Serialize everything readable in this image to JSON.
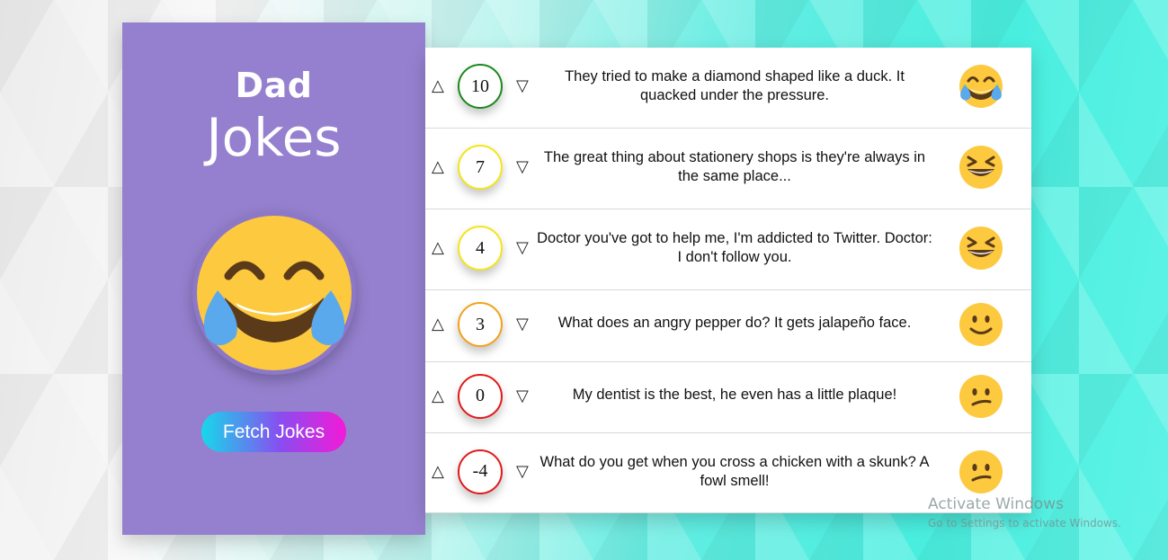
{
  "sidebar": {
    "title_line1": "Dad",
    "title_line2": "Jokes",
    "fetch_button": "Fetch Jokes"
  },
  "jokes": [
    {
      "score": "10",
      "score_color": "#1a8a1a",
      "text": "They tried to make a diamond shaped like a duck. It quacked under the pressure.",
      "emoji": "rolling-laughing-emoji"
    },
    {
      "score": "7",
      "score_color": "#f2e61a",
      "text": "The great thing about stationery shops is they're always in the same place...",
      "emoji": "grinning-squinting-emoji"
    },
    {
      "score": "4",
      "score_color": "#f2e61a",
      "text": "Doctor you've got to help me, I'm addicted to Twitter. Doctor: I don't follow you.",
      "emoji": "grinning-squinting-emoji"
    },
    {
      "score": "3",
      "score_color": "#f2a21a",
      "text": "What does an angry pepper do? It gets jalapeño face.",
      "emoji": "slightly-smiling-emoji"
    },
    {
      "score": "0",
      "score_color": "#e21a1a",
      "text": "My dentist is the best, he even has a little plaque!",
      "emoji": "confused-emoji"
    },
    {
      "score": "-4",
      "score_color": "#e21a1a",
      "text": "What do you get when you cross a chicken with a skunk? A fowl smell!",
      "emoji": "confused-emoji"
    }
  ],
  "vote": {
    "up": "△",
    "down": "▽"
  },
  "watermark": {
    "line1": "Activate Windows",
    "line2": "Go to Settings to activate Windows."
  }
}
